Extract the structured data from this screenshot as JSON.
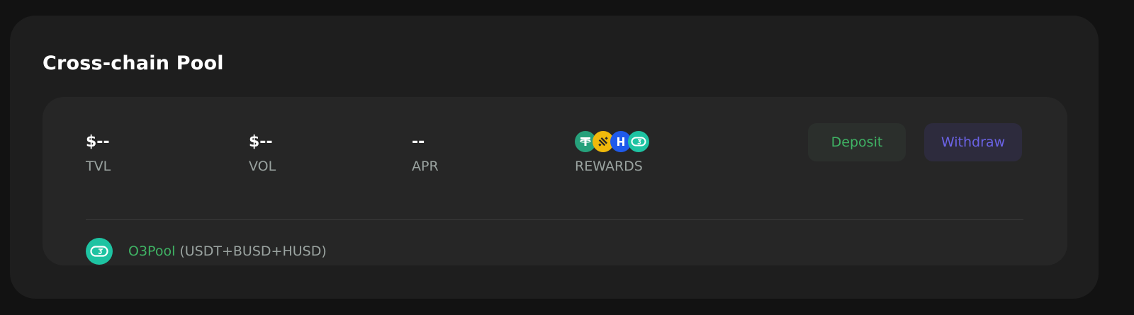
{
  "page": {
    "title": "Cross-chain Pool"
  },
  "stats": [
    {
      "value": "$--",
      "label": "TVL"
    },
    {
      "value": "$--",
      "label": "VOL"
    },
    {
      "value": "--",
      "label": "APR"
    },
    {
      "label": "REWARDS",
      "icons": [
        "usdt-icon",
        "busd-icon",
        "husd-icon",
        "o3-icon"
      ]
    }
  ],
  "actions": {
    "deposit_label": "Deposit",
    "withdraw_label": "Withdraw"
  },
  "pool": {
    "name": "O3Pool",
    "assets": "(USDT+BUSD+HUSD)"
  },
  "colors": {
    "accent_green": "#3fb364",
    "accent_purple": "#6b63e6",
    "usdt": "#26a17b",
    "busd": "#f0b90b",
    "husd": "#1f5aeb",
    "o3": "#1ec3a2"
  }
}
